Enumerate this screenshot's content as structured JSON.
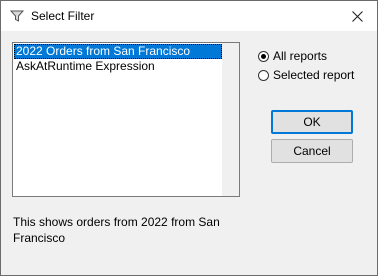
{
  "window": {
    "title": "Select Filter",
    "close_glyph": "✕",
    "icon": "filter-funnel-icon"
  },
  "filter_list": {
    "items": [
      {
        "label": "2022 Orders from San Francisco",
        "selected": true
      },
      {
        "label": "AskAtRuntime Expression",
        "selected": false
      }
    ]
  },
  "scope": {
    "options": [
      {
        "label": "All reports",
        "checked": true
      },
      {
        "label": "Selected report",
        "checked": false
      }
    ]
  },
  "buttons": {
    "ok": "OK",
    "cancel": "Cancel"
  },
  "description": "This shows orders from 2022 from San Francisco",
  "colors": {
    "accent": "#0078d7",
    "dialog_bg": "#f0f0f0"
  }
}
